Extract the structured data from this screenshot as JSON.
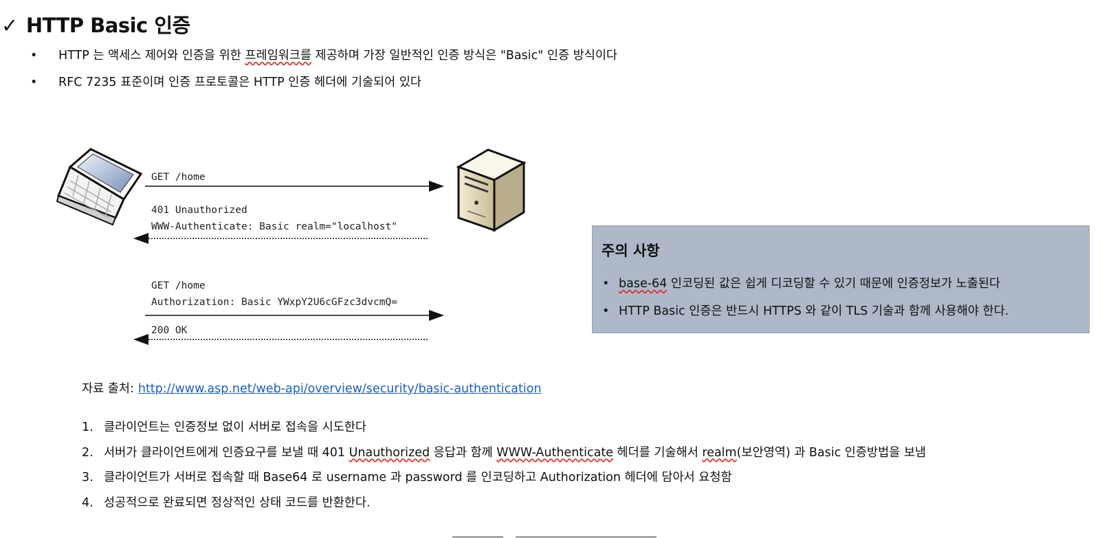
{
  "heading": {
    "check": "✓",
    "title": "HTTP Basic 인증"
  },
  "bullets": {
    "b1_pre": "HTTP 는 액세스 제어와 인증을 위한 ",
    "b1_squig": "프레임워크를",
    "b1_post": " 제공하며 가장 일반적인 인증 방식은 \"Basic\" 인증 방식이다",
    "b2": "RFC 7235 표준이며 인증 프로토콜은 HTTP 인증 헤더에 기술되어 있다"
  },
  "diagram": {
    "client_icon": "laptop-icon",
    "server_icon": "server-tower-icon",
    "m1": "GET /home",
    "m2a": "401 Unauthorized",
    "m2b": "WWW-Authenticate: Basic realm=\"localhost\"",
    "m3a": "GET /home",
    "m3b": "Authorization: Basic YWxpY2U6cGFzc3dvcmQ=",
    "m4": "200 OK"
  },
  "note": {
    "title": "주의 사항",
    "i1_squig": "base-64",
    "i1_post": " 인코딩된 값은 쉽게 디코딩할 수 있기 때문에 인증정보가 노출된다",
    "i2": "HTTP Basic 인증은 반드시 HTTPS 와 같이 TLS 기술과 함께 사용해야 한다."
  },
  "source": {
    "label": "자료 출처:",
    "link": "http://www.asp.net/web-api/overview/security/basic-authentication"
  },
  "steps": {
    "n1": "1.",
    "s1": "클라이언트는 인증정보 없이 서버로 접속을 시도한다",
    "n2": "2.",
    "s2_a": "서버가 클라이언트에게 인증요구를 보낼 때 401 ",
    "s2_b": "Unauthorized",
    "s2_c": " 응답과 함께 ",
    "s2_d": "WWW-Authenticate",
    "s2_e": " 헤더를 기술해서 ",
    "s2_f": "realm",
    "s2_g": "(보안영역) 과 Basic 인증방법을 보냄",
    "n3": "3.",
    "s3": "클라이언트가 서버로 접속할 때 Base64 로 username 과 password 를 인코딩하고 Authorization 헤더에 담아서 요청함",
    "n4": "4.",
    "s4": "성공적으로 완료되면 정상적인 상태 코드를 반환한다."
  },
  "colors": {
    "note_bg": "#aeb8c8",
    "link": "#1a5fc9",
    "spell": "#d93025"
  }
}
